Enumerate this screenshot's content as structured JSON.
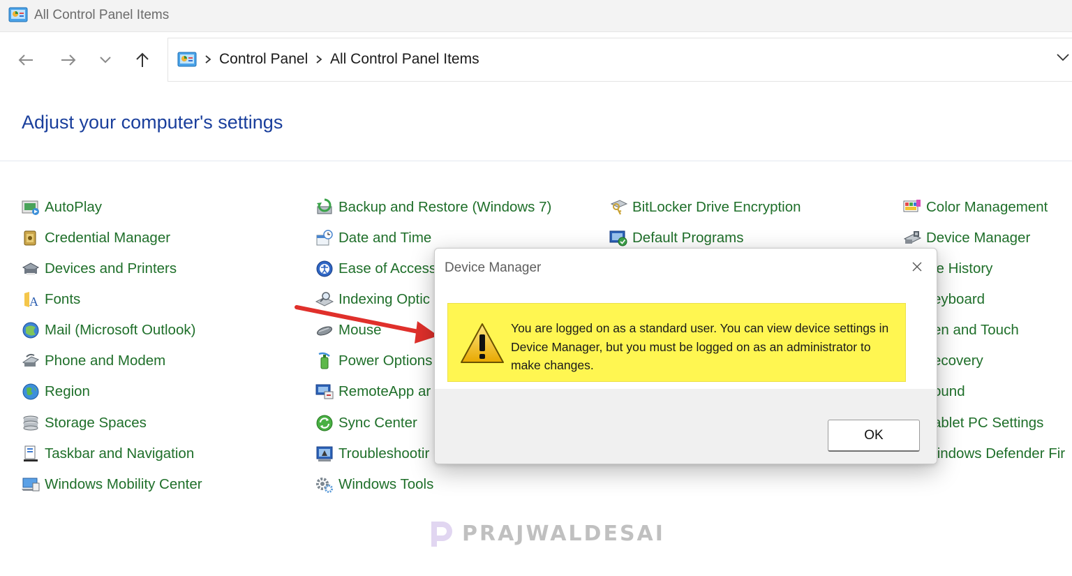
{
  "window": {
    "title": "All Control Panel Items"
  },
  "breadcrumb": [
    "Control Panel",
    "All Control Panel Items"
  ],
  "page": {
    "title": "Adjust your computer's settings"
  },
  "columns": [
    [
      {
        "label": "AutoPlay",
        "icon": "autoplay-icon"
      },
      {
        "label": "Credential Manager",
        "icon": "credential-manager-icon"
      },
      {
        "label": "Devices and Printers",
        "icon": "devices-printers-icon"
      },
      {
        "label": "Fonts",
        "icon": "fonts-icon"
      },
      {
        "label": "Mail (Microsoft Outlook)",
        "icon": "mail-icon"
      },
      {
        "label": "Phone and Modem",
        "icon": "phone-modem-icon"
      },
      {
        "label": "Region",
        "icon": "region-icon"
      },
      {
        "label": "Storage Spaces",
        "icon": "storage-spaces-icon"
      },
      {
        "label": "Taskbar and Navigation",
        "icon": "taskbar-icon"
      },
      {
        "label": "Windows Mobility Center",
        "icon": "mobility-center-icon"
      }
    ],
    [
      {
        "label": "Backup and Restore (Windows 7)",
        "icon": "backup-icon"
      },
      {
        "label": "Date and Time",
        "icon": "date-time-icon"
      },
      {
        "label": "Ease of Access",
        "icon": "ease-of-access-icon"
      },
      {
        "label": "Indexing Optic",
        "icon": "indexing-icon"
      },
      {
        "label": "Mouse",
        "icon": "mouse-icon"
      },
      {
        "label": "Power Options",
        "icon": "power-icon"
      },
      {
        "label": "RemoteApp ar",
        "icon": "remoteapp-icon"
      },
      {
        "label": "Sync Center",
        "icon": "sync-icon"
      },
      {
        "label": "Troubleshootir",
        "icon": "troubleshooting-icon"
      },
      {
        "label": "Windows Tools",
        "icon": "windows-tools-icon"
      }
    ],
    [
      {
        "label": "BitLocker Drive Encryption",
        "icon": "bitlocker-icon"
      },
      {
        "label": "Default Programs",
        "icon": "default-programs-icon"
      }
    ],
    [
      {
        "label": "Color Management",
        "icon": "color-management-icon"
      },
      {
        "label": "Device Manager",
        "icon": "device-manager-icon"
      },
      {
        "label": "le History",
        "icon": ""
      },
      {
        "label": "eyboard",
        "icon": ""
      },
      {
        "label": "en and Touch",
        "icon": ""
      },
      {
        "label": "ecovery",
        "icon": ""
      },
      {
        "label": "ound",
        "icon": ""
      },
      {
        "label": "ablet PC Settings",
        "icon": ""
      },
      {
        "label": "/indows Defender Fir",
        "icon": ""
      }
    ]
  ],
  "dialog": {
    "title": "Device Manager",
    "message": "You are logged on as a standard user. You can view device settings in Device Manager, but you must be logged on as an administrator to make changes.",
    "ok_label": "OK",
    "highlight_color": "#fff651"
  },
  "watermark": {
    "text": "PRAJWALDESAI"
  },
  "colors": {
    "link": "#1f6f2a",
    "title": "#1a3f9c",
    "annotation_arrow": "#e0302b"
  }
}
